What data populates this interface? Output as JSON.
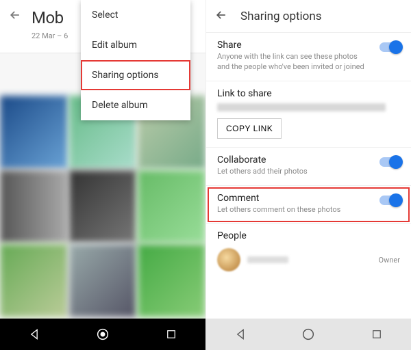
{
  "left": {
    "album_title": "Mob",
    "album_date_range": "22 Mar – 6",
    "menu": {
      "select": "Select",
      "edit": "Edit album",
      "sharing": "Sharing options",
      "delete": "Delete album"
    }
  },
  "right": {
    "title": "Sharing options",
    "share": {
      "label": "Share",
      "sub": "Anyone with the link can see these photos and the people who've been invited or joined"
    },
    "link": {
      "label": "Link to share",
      "copy_button": "COPY LINK"
    },
    "collaborate": {
      "label": "Collaborate",
      "sub": "Let others add their photos"
    },
    "comment": {
      "label": "Comment",
      "sub": "Let others comment on these photos"
    },
    "people": {
      "label": "People",
      "owner_role": "Owner"
    }
  }
}
